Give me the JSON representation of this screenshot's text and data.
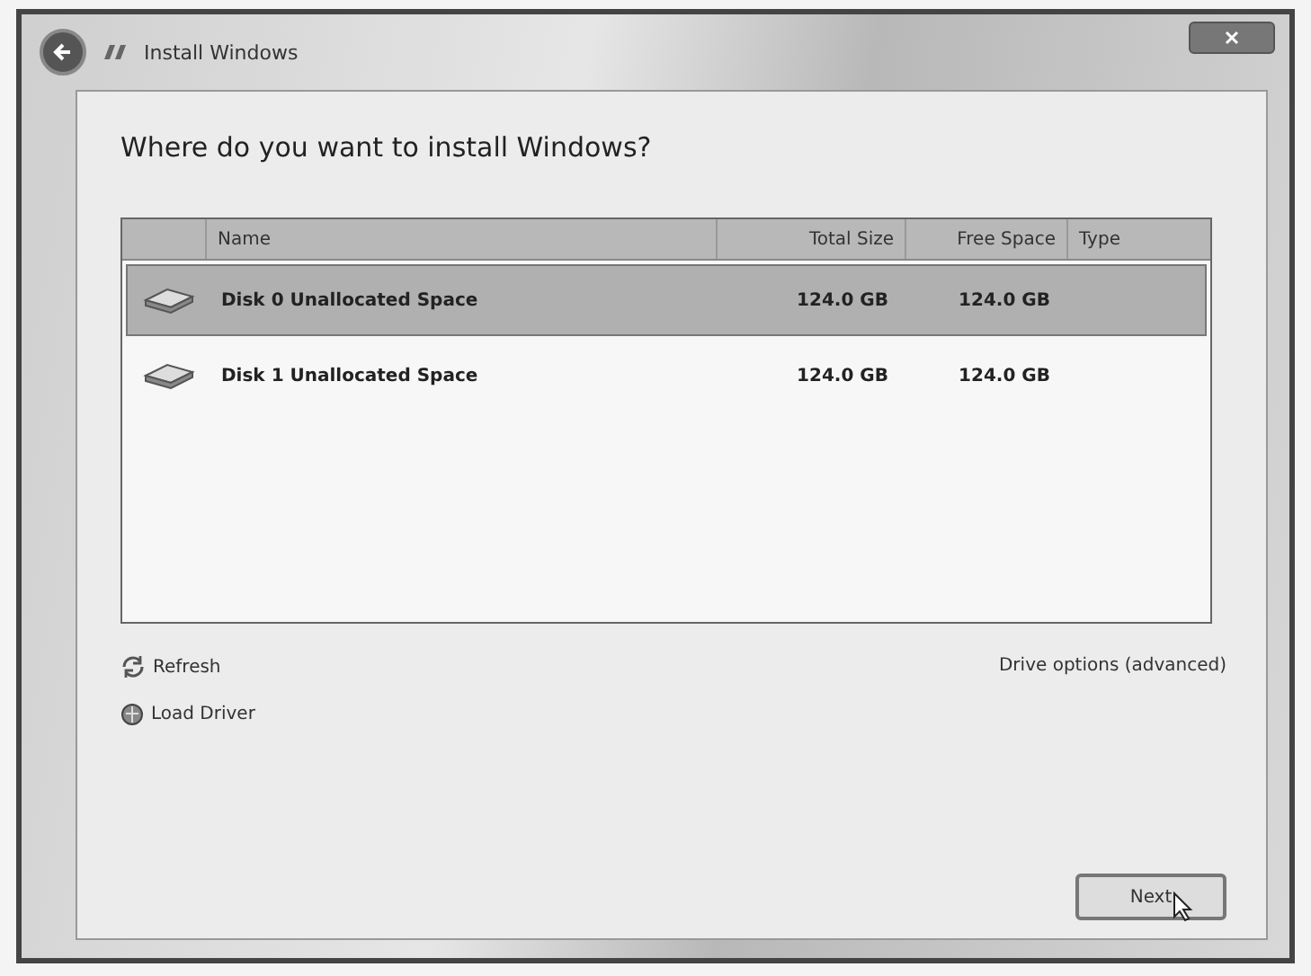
{
  "window": {
    "title": "Install Windows"
  },
  "heading": "Where do you want to install Windows?",
  "table": {
    "columns": [
      "Name",
      "Total Size",
      "Free Space",
      "Type"
    ],
    "rows": [
      {
        "name": "Disk 0 Unallocated Space",
        "total_size": "124.0 GB",
        "free_space": "124.0 GB",
        "selected": true
      },
      {
        "name": "Disk 1 Unallocated Space",
        "total_size": "124.0 GB",
        "free_space": "124.0 GB",
        "selected": false
      }
    ]
  },
  "links": {
    "refresh": "Refresh",
    "load_driver": "Load Driver",
    "drive_options": "Drive options (advanced)"
  },
  "buttons": {
    "next": "Next"
  }
}
